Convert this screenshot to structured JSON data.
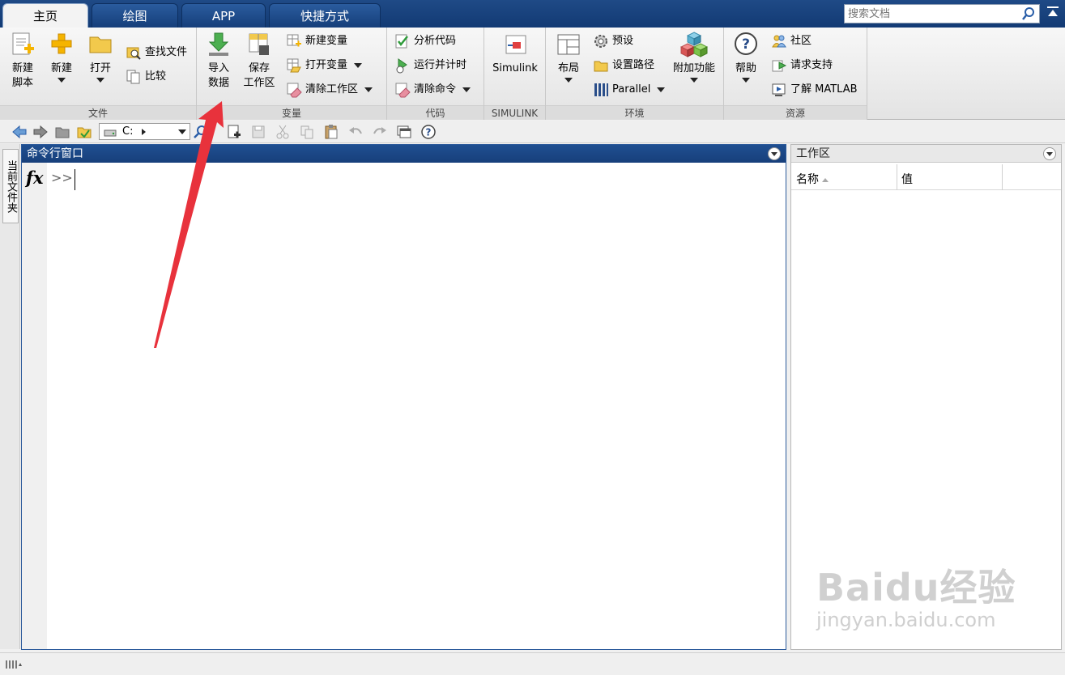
{
  "tabs": [
    {
      "label": "主页",
      "active": true
    },
    {
      "label": "绘图",
      "active": false
    },
    {
      "label": "APP",
      "active": false
    },
    {
      "label": "快捷方式",
      "active": false
    }
  ],
  "search": {
    "placeholder": "搜索文档"
  },
  "ribbon": {
    "file": {
      "label": "文件",
      "new_script": "新建\n脚本",
      "new": "新建",
      "open": "打开",
      "find_files": "查找文件",
      "compare": "比较"
    },
    "variable": {
      "label": "变量",
      "import_data": "导入\n数据",
      "save_workspace": "保存\n工作区",
      "new_variable": "新建变量",
      "open_variable": "打开变量",
      "clear_workspace": "清除工作区"
    },
    "code": {
      "label": "代码",
      "analyze_code": "分析代码",
      "run_and_time": "运行并计时",
      "clear_commands": "清除命令"
    },
    "simulink": {
      "label": "SIMULINK",
      "simulink": "Simulink"
    },
    "environment": {
      "label": "环境",
      "layout": "布局",
      "preferences": "预设",
      "set_path": "设置路径",
      "parallel": "Parallel",
      "addons": "附加功能"
    },
    "resources": {
      "label": "资源",
      "help": "帮助",
      "community": "社区",
      "request_support": "请求支持",
      "learn_matlab": "了解 MATLAB"
    }
  },
  "toolbar": {
    "current_path": "C:"
  },
  "side_panel": {
    "current_folder": "当前文件夹"
  },
  "command_window": {
    "title": "命令行窗口",
    "fx": "fx",
    "prompt": ">>"
  },
  "workspace": {
    "title": "工作区",
    "col_name": "名称",
    "col_value": "值"
  },
  "watermark": {
    "logo": "Baidu经验",
    "url": "jingyan.baidu.com"
  },
  "colors": {
    "title_bar": "#1a4582",
    "annotation_arrow": "#e8323c"
  }
}
